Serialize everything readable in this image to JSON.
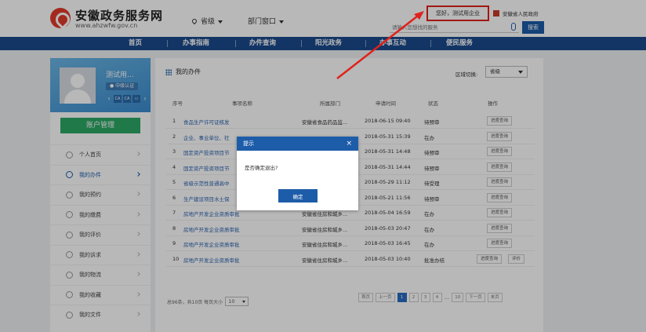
{
  "header": {
    "site_title": "安徽政务服务网",
    "site_url": "www.ahzwfw.gov.cn",
    "region_dropdown": "省级",
    "dept_dropdown": "部门窗口",
    "greeting": "您好，测试用企业",
    "gov_link": "安徽省人民政府",
    "search_placeholder": "请输入您想找的服务",
    "search_button": "搜索"
  },
  "nav": {
    "items": [
      "首页",
      "办事指南",
      "办件查询",
      "阳光政务",
      "办事互动",
      "便民服务"
    ]
  },
  "sidebar": {
    "user_name": "测试用...",
    "badge": "中级认证",
    "id_tags": [
      "CA",
      "CA"
    ],
    "account_button": "账户管理",
    "menu": [
      {
        "label": "个人首页",
        "icon": "user-icon"
      },
      {
        "label": "我的办件",
        "icon": "people-icon"
      },
      {
        "label": "我的预约",
        "icon": "clock-icon"
      },
      {
        "label": "我的缴费",
        "icon": "wallet-icon"
      },
      {
        "label": "我的评价",
        "icon": "comment-icon"
      },
      {
        "label": "我的诉求",
        "icon": "chat-icon"
      },
      {
        "label": "我的物流",
        "icon": "truck-icon"
      },
      {
        "label": "我的收藏",
        "icon": "star-icon"
      },
      {
        "label": "我的文件",
        "icon": "file-icon"
      }
    ],
    "active_index": 1
  },
  "main": {
    "title": "我的办件",
    "region_label": "区域切换:",
    "region_value": "省级",
    "columns": [
      "序号",
      "事项名称",
      "所属部门",
      "申请时间",
      "状态",
      "操作"
    ],
    "rows": [
      {
        "num": "1",
        "name": "食品生产许可证核发",
        "dept": "安徽省食品药品监...",
        "time": "2018-06-15 09:40",
        "status": "待预审",
        "actions": [
          "进度查询"
        ]
      },
      {
        "num": "2",
        "name": "企业、事业单位、社",
        "dept": "",
        "time": "2018-05-31 15:39",
        "status": "在办",
        "actions": [
          "进度查询"
        ]
      },
      {
        "num": "3",
        "name": "固定资产投资项目节",
        "dept": "",
        "time": "2018-05-31 14:48",
        "status": "待预审",
        "actions": [
          "进度查询"
        ]
      },
      {
        "num": "4",
        "name": "固定资产投资项目节",
        "dept": "",
        "time": "2018-05-31 14:44",
        "status": "待预审",
        "actions": [
          "进度查询"
        ]
      },
      {
        "num": "5",
        "name": "省级示范性普通高中",
        "dept": "",
        "time": "2018-05-29 11:12",
        "status": "待受理",
        "actions": [
          "进度查询"
        ]
      },
      {
        "num": "6",
        "name": "生产建设项目水土保",
        "dept": "",
        "time": "2018-05-21 11:56",
        "status": "待预审",
        "actions": [
          "进度查询"
        ]
      },
      {
        "num": "7",
        "name": "房地产开发企业资质审批",
        "dept": "安徽省住房和城乡...",
        "time": "2018-05-04 16:59",
        "status": "在办",
        "actions": [
          "进度查询"
        ]
      },
      {
        "num": "8",
        "name": "房地产开发企业资质审批",
        "dept": "安徽省住房和城乡...",
        "time": "2018-05-03 20:47",
        "status": "在办",
        "actions": [
          "进度查询"
        ]
      },
      {
        "num": "9",
        "name": "房地产开发企业资质审批",
        "dept": "安徽省住房和城乡...",
        "time": "2018-05-03 16:45",
        "status": "在办",
        "actions": [
          "进度查询"
        ]
      },
      {
        "num": "10",
        "name": "房地产开发企业资质审批",
        "dept": "安徽省住房和城乡...",
        "time": "2018-05-03 10:40",
        "status": "批准办结",
        "actions": [
          "进度查询",
          "评价"
        ]
      }
    ],
    "pager_info": "总96条，共10页 每页大小",
    "per_page": "10",
    "pager": [
      "首页",
      "上一页",
      "1",
      "2",
      "3",
      "4",
      "...",
      "10",
      "下一页",
      "末页"
    ],
    "current_page": "1"
  },
  "dialog": {
    "title": "提示",
    "close": "×",
    "message": "是否确定退出?",
    "ok": "确定"
  },
  "colors": {
    "nav_bg": "#1a4a8c",
    "accent": "#1d5ca8",
    "account_green": "#2ca866",
    "highlight_red": "#e0221b"
  }
}
